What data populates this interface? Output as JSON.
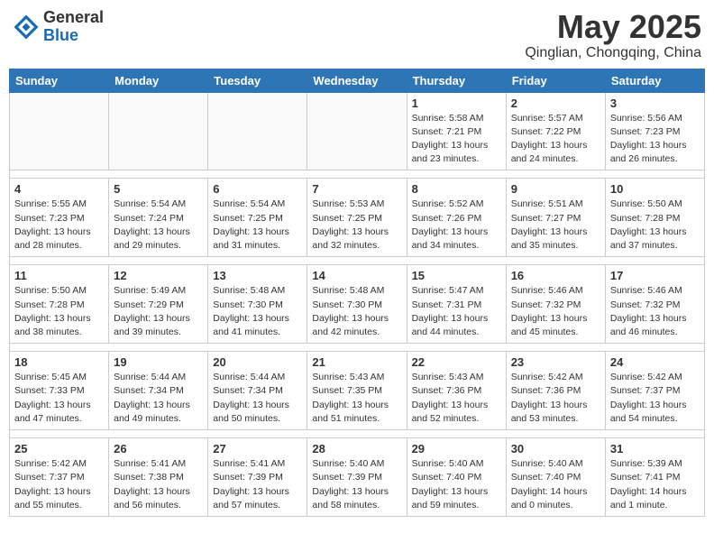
{
  "logo": {
    "general": "General",
    "blue": "Blue"
  },
  "title": "May 2025",
  "location": "Qinglian, Chongqing, China",
  "headers": [
    "Sunday",
    "Monday",
    "Tuesday",
    "Wednesday",
    "Thursday",
    "Friday",
    "Saturday"
  ],
  "weeks": [
    [
      {
        "day": "",
        "info": ""
      },
      {
        "day": "",
        "info": ""
      },
      {
        "day": "",
        "info": ""
      },
      {
        "day": "",
        "info": ""
      },
      {
        "day": "1",
        "info": "Sunrise: 5:58 AM\nSunset: 7:21 PM\nDaylight: 13 hours\nand 23 minutes."
      },
      {
        "day": "2",
        "info": "Sunrise: 5:57 AM\nSunset: 7:22 PM\nDaylight: 13 hours\nand 24 minutes."
      },
      {
        "day": "3",
        "info": "Sunrise: 5:56 AM\nSunset: 7:23 PM\nDaylight: 13 hours\nand 26 minutes."
      }
    ],
    [
      {
        "day": "4",
        "info": "Sunrise: 5:55 AM\nSunset: 7:23 PM\nDaylight: 13 hours\nand 28 minutes."
      },
      {
        "day": "5",
        "info": "Sunrise: 5:54 AM\nSunset: 7:24 PM\nDaylight: 13 hours\nand 29 minutes."
      },
      {
        "day": "6",
        "info": "Sunrise: 5:54 AM\nSunset: 7:25 PM\nDaylight: 13 hours\nand 31 minutes."
      },
      {
        "day": "7",
        "info": "Sunrise: 5:53 AM\nSunset: 7:25 PM\nDaylight: 13 hours\nand 32 minutes."
      },
      {
        "day": "8",
        "info": "Sunrise: 5:52 AM\nSunset: 7:26 PM\nDaylight: 13 hours\nand 34 minutes."
      },
      {
        "day": "9",
        "info": "Sunrise: 5:51 AM\nSunset: 7:27 PM\nDaylight: 13 hours\nand 35 minutes."
      },
      {
        "day": "10",
        "info": "Sunrise: 5:50 AM\nSunset: 7:28 PM\nDaylight: 13 hours\nand 37 minutes."
      }
    ],
    [
      {
        "day": "11",
        "info": "Sunrise: 5:50 AM\nSunset: 7:28 PM\nDaylight: 13 hours\nand 38 minutes."
      },
      {
        "day": "12",
        "info": "Sunrise: 5:49 AM\nSunset: 7:29 PM\nDaylight: 13 hours\nand 39 minutes."
      },
      {
        "day": "13",
        "info": "Sunrise: 5:48 AM\nSunset: 7:30 PM\nDaylight: 13 hours\nand 41 minutes."
      },
      {
        "day": "14",
        "info": "Sunrise: 5:48 AM\nSunset: 7:30 PM\nDaylight: 13 hours\nand 42 minutes."
      },
      {
        "day": "15",
        "info": "Sunrise: 5:47 AM\nSunset: 7:31 PM\nDaylight: 13 hours\nand 44 minutes."
      },
      {
        "day": "16",
        "info": "Sunrise: 5:46 AM\nSunset: 7:32 PM\nDaylight: 13 hours\nand 45 minutes."
      },
      {
        "day": "17",
        "info": "Sunrise: 5:46 AM\nSunset: 7:32 PM\nDaylight: 13 hours\nand 46 minutes."
      }
    ],
    [
      {
        "day": "18",
        "info": "Sunrise: 5:45 AM\nSunset: 7:33 PM\nDaylight: 13 hours\nand 47 minutes."
      },
      {
        "day": "19",
        "info": "Sunrise: 5:44 AM\nSunset: 7:34 PM\nDaylight: 13 hours\nand 49 minutes."
      },
      {
        "day": "20",
        "info": "Sunrise: 5:44 AM\nSunset: 7:34 PM\nDaylight: 13 hours\nand 50 minutes."
      },
      {
        "day": "21",
        "info": "Sunrise: 5:43 AM\nSunset: 7:35 PM\nDaylight: 13 hours\nand 51 minutes."
      },
      {
        "day": "22",
        "info": "Sunrise: 5:43 AM\nSunset: 7:36 PM\nDaylight: 13 hours\nand 52 minutes."
      },
      {
        "day": "23",
        "info": "Sunrise: 5:42 AM\nSunset: 7:36 PM\nDaylight: 13 hours\nand 53 minutes."
      },
      {
        "day": "24",
        "info": "Sunrise: 5:42 AM\nSunset: 7:37 PM\nDaylight: 13 hours\nand 54 minutes."
      }
    ],
    [
      {
        "day": "25",
        "info": "Sunrise: 5:42 AM\nSunset: 7:37 PM\nDaylight: 13 hours\nand 55 minutes."
      },
      {
        "day": "26",
        "info": "Sunrise: 5:41 AM\nSunset: 7:38 PM\nDaylight: 13 hours\nand 56 minutes."
      },
      {
        "day": "27",
        "info": "Sunrise: 5:41 AM\nSunset: 7:39 PM\nDaylight: 13 hours\nand 57 minutes."
      },
      {
        "day": "28",
        "info": "Sunrise: 5:40 AM\nSunset: 7:39 PM\nDaylight: 13 hours\nand 58 minutes."
      },
      {
        "day": "29",
        "info": "Sunrise: 5:40 AM\nSunset: 7:40 PM\nDaylight: 13 hours\nand 59 minutes."
      },
      {
        "day": "30",
        "info": "Sunrise: 5:40 AM\nSunset: 7:40 PM\nDaylight: 14 hours\nand 0 minutes."
      },
      {
        "day": "31",
        "info": "Sunrise: 5:39 AM\nSunset: 7:41 PM\nDaylight: 14 hours\nand 1 minute."
      }
    ]
  ]
}
